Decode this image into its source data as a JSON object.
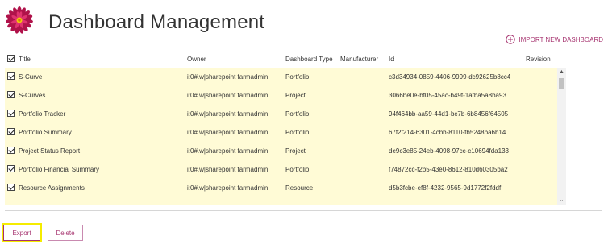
{
  "header": {
    "title": "Dashboard Management",
    "import_label": "IMPORT NEW DASHBOARD",
    "logo_icon": "flower-logo-icon",
    "import_icon": "plus-circle-icon"
  },
  "table": {
    "columns": {
      "title": "Title",
      "owner": "Owner",
      "type": "Dashboard Type",
      "manufacturer": "Manufacturer",
      "id": "Id",
      "revision": "Revision"
    },
    "rows": [
      {
        "checked": true,
        "title": "S-Curve",
        "owner": "i:0#.w|sharepoint farmadmin",
        "type": "Portfolio",
        "manufacturer": "",
        "id": "c3d34934-0859-4406-9999-dc92625b8cc4",
        "revision": ""
      },
      {
        "checked": true,
        "title": "S-Curves",
        "owner": "i:0#.w|sharepoint farmadmin",
        "type": "Project",
        "manufacturer": "",
        "id": "3066be0e-bf05-45ac-b49f-1afba5a8ba93",
        "revision": ""
      },
      {
        "checked": true,
        "title": "Portfolio Tracker",
        "owner": "i:0#.w|sharepoint farmadmin",
        "type": "Portfolio",
        "manufacturer": "",
        "id": "94f464bb-aa59-44d1-bc7b-6b8456f64505",
        "revision": ""
      },
      {
        "checked": true,
        "title": "Portfolio Summary",
        "owner": "i:0#.w|sharepoint farmadmin",
        "type": "Portfolio",
        "manufacturer": "",
        "id": "67f2f214-6301-4cbb-8110-fb5248ba6b14",
        "revision": ""
      },
      {
        "checked": true,
        "title": "Project Status Report",
        "owner": "i:0#.w|sharepoint farmadmin",
        "type": "Project",
        "manufacturer": "",
        "id": "de9c3e85-24eb-4098-97cc-c10694fda133",
        "revision": ""
      },
      {
        "checked": true,
        "title": "Portfolio Financial Summary",
        "owner": "i:0#.w|sharepoint farmadmin",
        "type": "Portfolio",
        "manufacturer": "",
        "id": "f74872cc-f2b5-43e0-8612-810d60305ba2",
        "revision": ""
      },
      {
        "checked": true,
        "title": "Resource Assignments",
        "owner": "i:0#.w|sharepoint farmadmin",
        "type": "Resource",
        "manufacturer": "",
        "id": "d5b3fcbe-ef8f-4232-9565-9d1772f2fddf",
        "revision": ""
      }
    ]
  },
  "buttons": {
    "export_label": "Export",
    "delete_label": "Delete"
  },
  "colors": {
    "accent": "#a6336f",
    "row_highlight": "#fffbd6",
    "focus_outline": "#f5ec00"
  }
}
